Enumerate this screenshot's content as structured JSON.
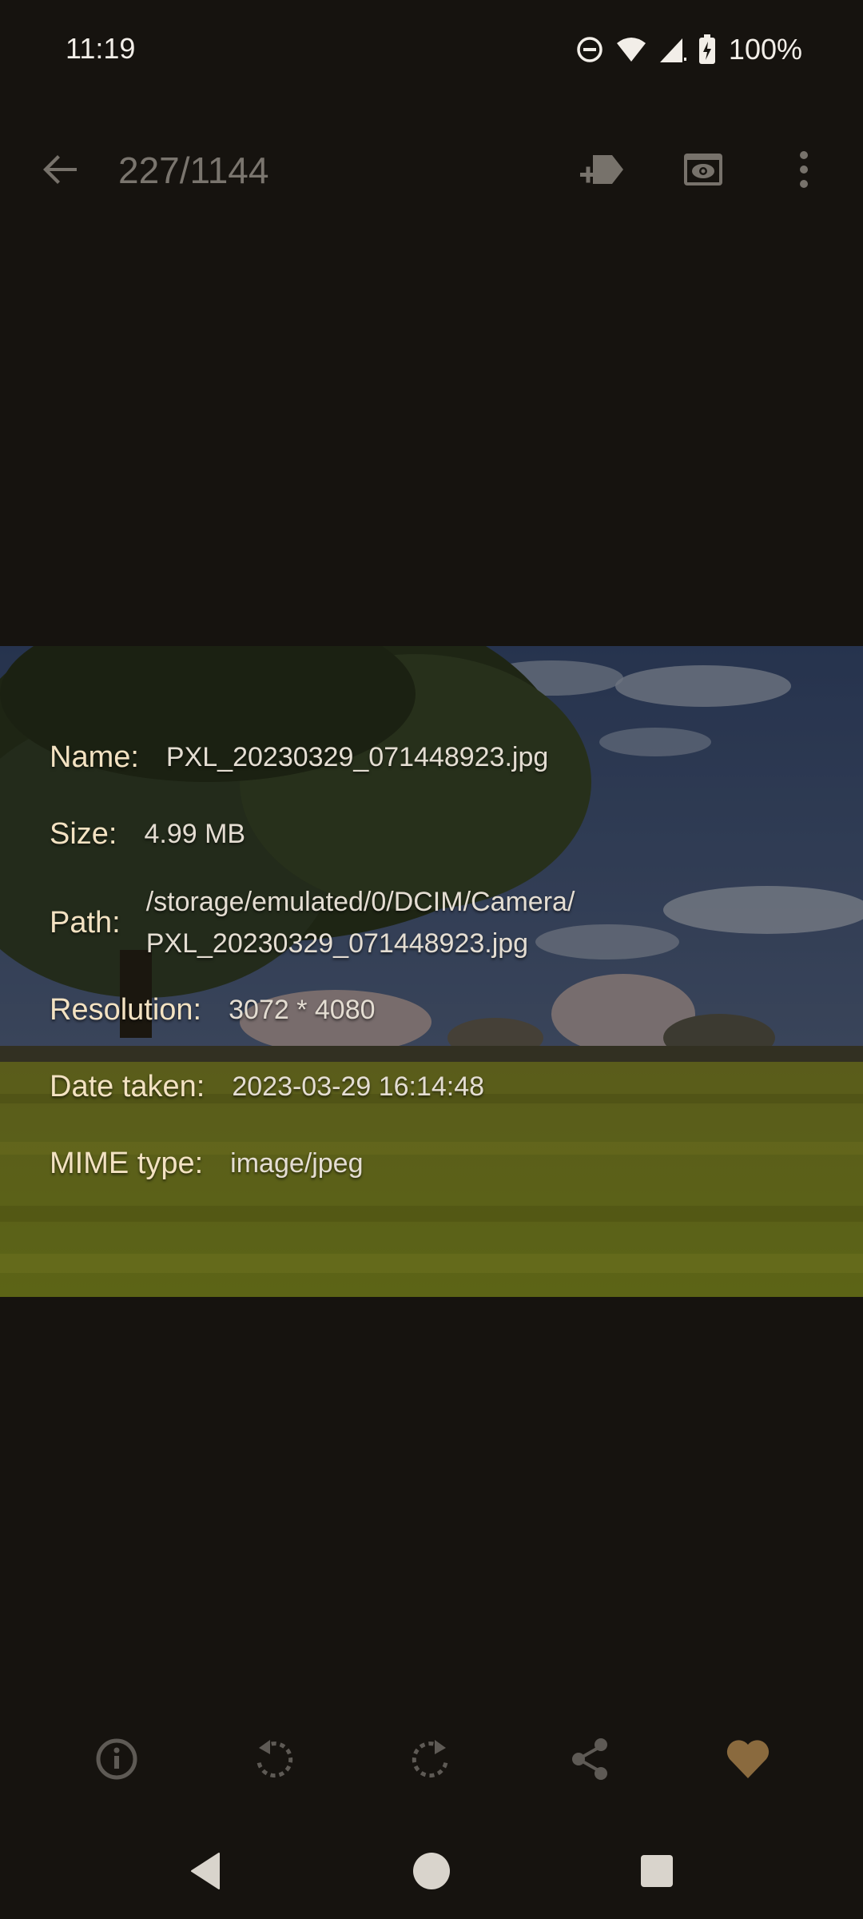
{
  "status_bar": {
    "time": "11:19",
    "battery": "100%",
    "icons": [
      "do-not-disturb-icon",
      "wifi-icon",
      "signal-icon",
      "battery-charging-icon"
    ]
  },
  "toolbar": {
    "counter": "227/1144",
    "icons": [
      "back-arrow-icon",
      "add-tag-icon",
      "slideshow-icon",
      "more-vert-icon"
    ]
  },
  "info": {
    "name_label": "Name:",
    "name_value": "PXL_20230329_071448923.jpg",
    "size_label": "Size:",
    "size_value": "4.99 MB",
    "path_label": "Path:",
    "path_line1": "/storage/emulated/0/DCIM/Camera/",
    "path_line2": "PXL_20230329_071448923.jpg",
    "resolution_label": "Resolution:",
    "resolution_value": "3072 * 4080",
    "date_label": "Date taken:",
    "date_value": "2023-03-29 16:14:48",
    "mime_label": "MIME type:",
    "mime_value": "image/jpeg"
  },
  "actions": {
    "icons": [
      "info-icon",
      "rotate-left-icon",
      "rotate-right-icon",
      "share-icon",
      "favorite-heart-icon"
    ],
    "favorite_color": "#8a6a3e",
    "icon_color": "#5e5a55"
  },
  "nav_bar": {
    "icons": [
      "nav-back-icon",
      "nav-home-icon",
      "nav-recents-icon"
    ]
  },
  "colors": {
    "background": "#16130f",
    "toolbar_icon": "#77726b",
    "label": "#f3e2c2"
  }
}
